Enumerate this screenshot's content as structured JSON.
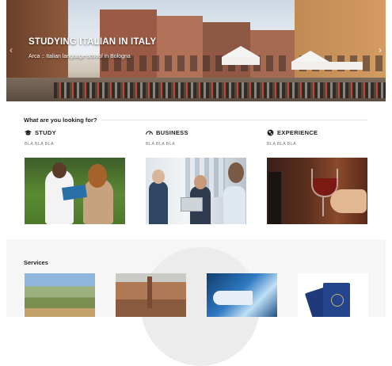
{
  "hero": {
    "title": "STUDYING ITALIAN IN ITALY",
    "subtitle": "Arca :: Italian language school in Bologna",
    "prev_arrow": "‹",
    "next_arrow": "›"
  },
  "looking_for": {
    "title": "What are you looking for?",
    "columns": [
      {
        "title": "STUDY",
        "icon": "graduation-cap-icon",
        "text": "BLA BLA BLA"
      },
      {
        "title": "BUSINESS",
        "icon": "speedometer-icon",
        "text": "BLA BLA BLA"
      },
      {
        "title": "EXPERIENCE",
        "icon": "globe-icon",
        "text": "BLA BLA BLA"
      }
    ]
  },
  "services": {
    "title": "Services"
  }
}
